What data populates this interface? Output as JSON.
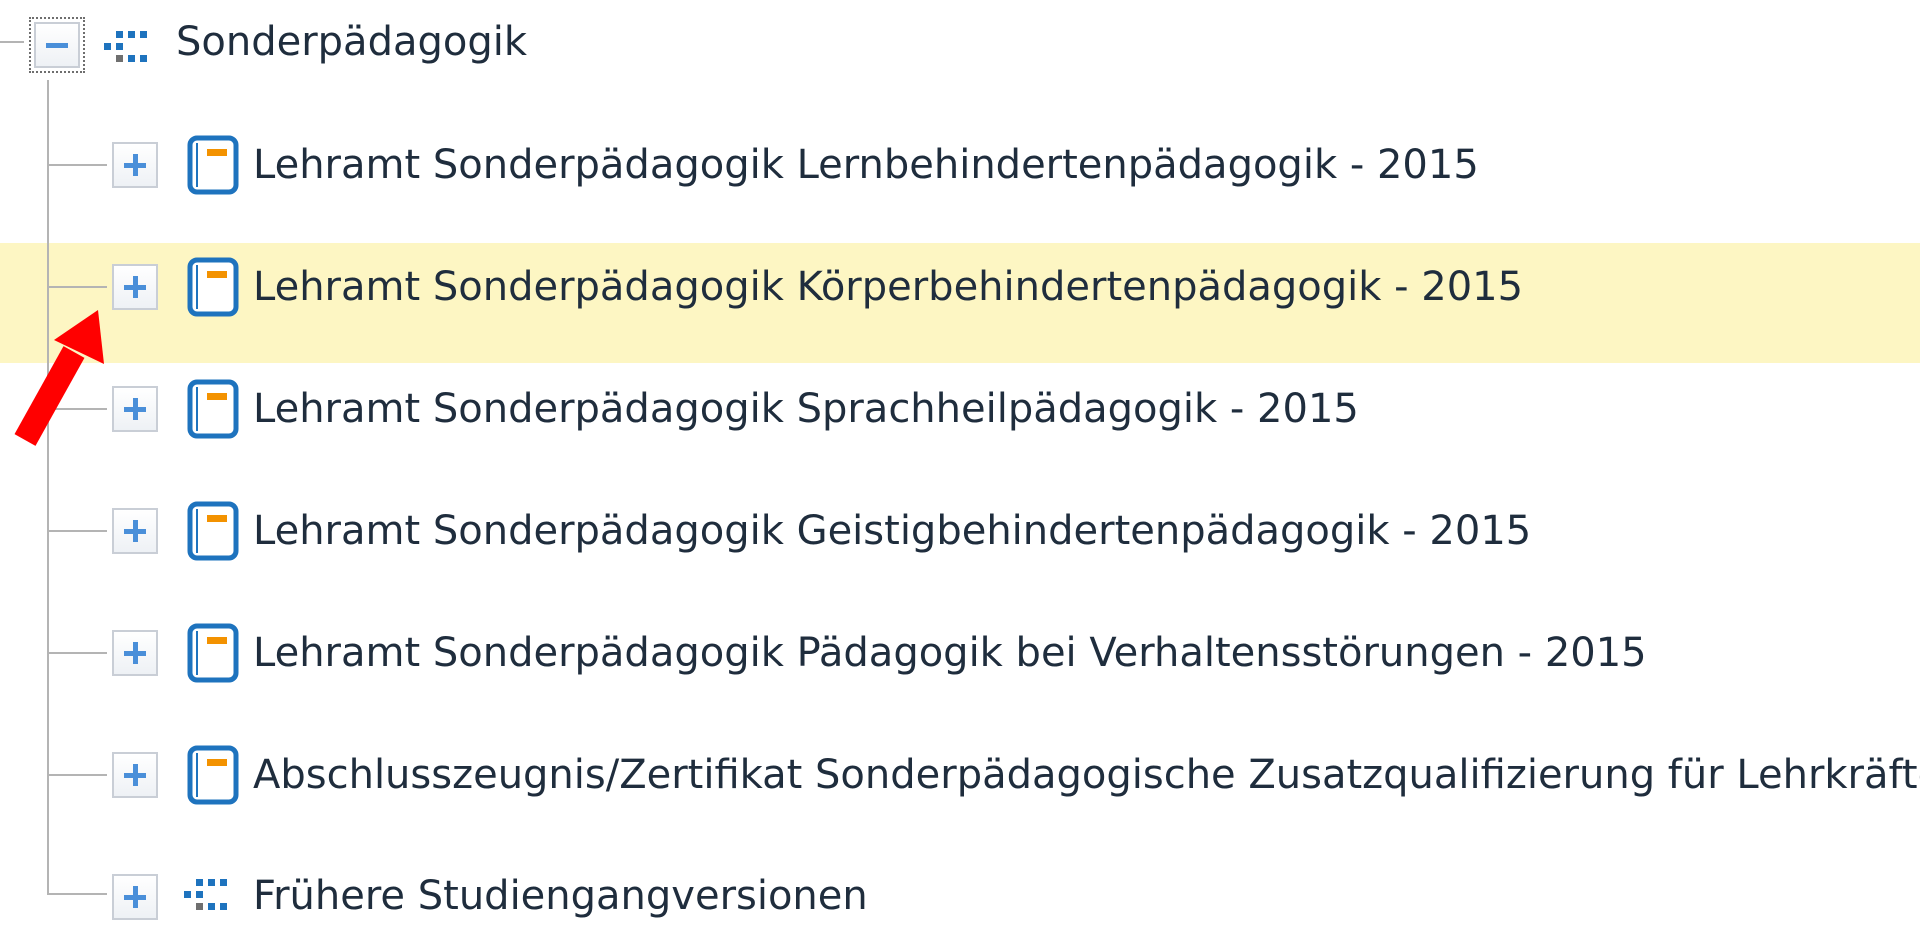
{
  "tree": {
    "root": {
      "label": "Sonderpädagogik",
      "icon": "structure-icon",
      "expanded": true
    },
    "children": [
      {
        "label": "Lehramt Sonderpädagogik Lernbehindertenpädagogik - 2015",
        "icon": "book-icon"
      },
      {
        "label": "Lehramt Sonderpädagogik Körperbehindertenpädagogik - 2015",
        "icon": "book-icon"
      },
      {
        "label": "Lehramt Sonderpädagogik Sprachheilpädagogik - 2015",
        "icon": "book-icon"
      },
      {
        "label": "Lehramt Sonderpädagogik Geistigbehindertenpädagogik - 2015",
        "icon": "book-icon"
      },
      {
        "label": "Lehramt Sonderpädagogik Pädagogik bei Verhaltensstörungen - 2015",
        "icon": "book-icon"
      },
      {
        "label": "Abschlusszeugnis/Zertifikat Sonderpädagogische Zusatzqualifizierung für Lehrkräfte",
        "icon": "book-icon"
      },
      {
        "label": "Frühere Studiengangversionen",
        "icon": "structure-icon"
      }
    ]
  },
  "colors": {
    "highlight_row": "#fdf6c3",
    "toggle_blue": "#4a8fd9",
    "book_blue": "#1e73be",
    "book_orange": "#f39200",
    "annotation_arrow": "#ff0000"
  }
}
